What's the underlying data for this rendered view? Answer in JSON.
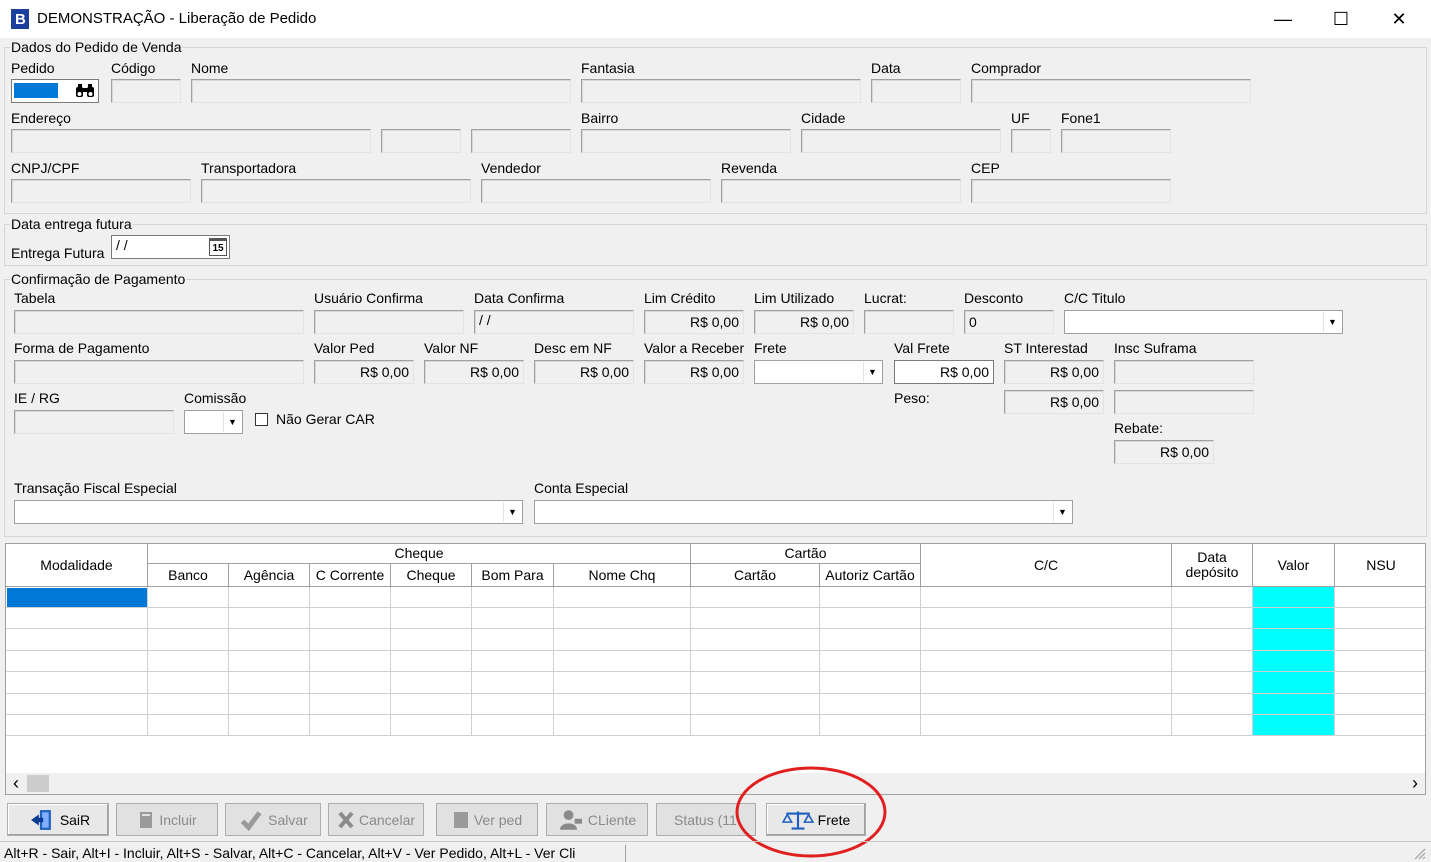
{
  "window": {
    "title": "DEMONSTRAÇÃO - Liberação de Pedido",
    "minimize": "—",
    "maximize": "☐",
    "close": "✕"
  },
  "pedido_group": {
    "title": "Dados do Pedido de Venda",
    "labels": {
      "pedido": "Pedido",
      "codigo": "Código",
      "nome": "Nome",
      "fantasia": "Fantasia",
      "data": "Data",
      "comprador": "Comprador",
      "endereco": "Endereço",
      "bairro": "Bairro",
      "cidade": "Cidade",
      "uf": "UF",
      "fone1": "Fone1",
      "cnpj": "CNPJ/CPF",
      "transportadora": "Transportadora",
      "vendedor": "Vendedor",
      "revenda": "Revenda",
      "cep": "CEP"
    }
  },
  "entrega_group": {
    "title": "Data entrega futura",
    "label": "Entrega Futura",
    "value": " /  /",
    "calendar_day": "15"
  },
  "pagamento_group": {
    "title": "Confirmação de Pagamento",
    "labels": {
      "tabela": "Tabela",
      "usuario_confirma": "Usuário Confirma",
      "data_confirma": "Data Confirma",
      "lim_credito": "Lim Crédito",
      "lim_utilizado": "Lim Utilizado",
      "lucrat": "Lucrat:",
      "desconto": "Desconto",
      "cc_titulo": "C/C Titulo",
      "forma_pagamento": "Forma de Pagamento",
      "valor_ped": "Valor Ped",
      "valor_nf": "Valor NF",
      "desc_nf": "Desc em NF",
      "valor_receber": "Valor a Receber",
      "frete": "Frete",
      "val_frete": "Val Frete",
      "st_interestad": "ST Interestad",
      "insc_suframa": "Insc Suframa",
      "ie_rg": "IE / RG",
      "comissao": "Comissão",
      "nao_gerar_car": "Não Gerar CAR",
      "peso": "Peso:",
      "rebate": "Rebate:",
      "transacao": "Transação Fiscal Especial",
      "conta_especial": "Conta Especial"
    },
    "values": {
      "data_confirma": " /  /",
      "lim_credito": "R$ 0,00",
      "lim_utilizado": "R$ 0,00",
      "desconto": "0",
      "valor_ped": "R$ 0,00",
      "valor_nf": "R$ 0,00",
      "desc_nf": "R$ 0,00",
      "valor_receber": "R$ 0,00",
      "val_frete": "R$ 0,00",
      "st_interestad": "R$ 0,00",
      "peso": "R$ 0,00",
      "rebate": "R$ 0,00"
    }
  },
  "grid": {
    "group_headers": {
      "cheque": "Cheque",
      "cartao": "Cartão"
    },
    "columns": {
      "modalidade": "Modalidade",
      "banco": "Banco",
      "agencia": "Agência",
      "c_corrente": "C Corrente",
      "cheque": "Cheque",
      "bom_para": "Bom Para",
      "nome_chq": "Nome Chq",
      "cartao": "Cartão",
      "autoriz_cartao": "Autoriz Cartão",
      "cc": "C/C",
      "data_deposito": "Data depósito",
      "valor": "Valor",
      "nsu": "NSU"
    },
    "scroll_left": "‹",
    "scroll_right": "›"
  },
  "buttons": {
    "sair": "SaiR",
    "incluir": "Incluir",
    "salvar": "Salvar",
    "cancelar": "Cancelar",
    "ver_ped": "Ver ped",
    "cliente": "CLiente",
    "status": "Status (11",
    "frete": "Frete"
  },
  "statusbar": {
    "text": "Alt+R - Sair, Alt+I - Incluir, Alt+S - Salvar, Alt+C - Cancelar, Alt+V - Ver Pedido, Alt+L - Ver Cli"
  },
  "colors": {
    "selection": "#0078d7",
    "valor_column": "#00ffff",
    "highlight_circle": "#e0201f"
  }
}
